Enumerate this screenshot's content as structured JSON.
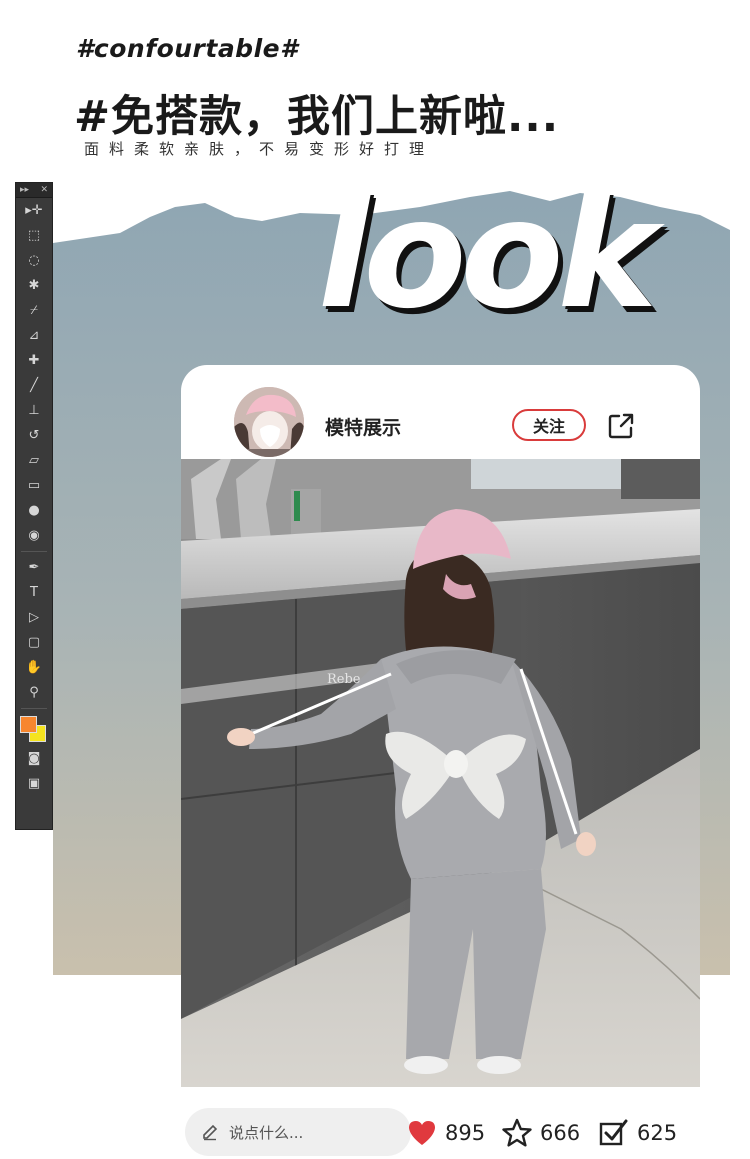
{
  "header": {
    "hashtag": "#confourtable#",
    "headline": "#免搭款，我们上新啦...",
    "subline": "面料柔软亲肤，不易变形好打理"
  },
  "banner": {
    "word": "look",
    "colors": {
      "top": "#8fa6b3",
      "bottom": "#c7bfae"
    }
  },
  "toolbar": {
    "header_left": "▸▸",
    "header_right": "✕",
    "tools": [
      {
        "name": "move-tool-icon",
        "glyph": "▸✛"
      },
      {
        "name": "marquee-tool-icon",
        "glyph": "⬚"
      },
      {
        "name": "lasso-tool-icon",
        "glyph": "◌"
      },
      {
        "name": "magic-wand-tool-icon",
        "glyph": "✱"
      },
      {
        "name": "crop-tool-icon",
        "glyph": "⌿"
      },
      {
        "name": "eyedropper-tool-icon",
        "glyph": "⊿"
      },
      {
        "name": "healing-brush-tool-icon",
        "glyph": "✚"
      },
      {
        "name": "brush-tool-icon",
        "glyph": "╱"
      },
      {
        "name": "stamp-tool-icon",
        "glyph": "⊥"
      },
      {
        "name": "history-brush-tool-icon",
        "glyph": "↺"
      },
      {
        "name": "eraser-tool-icon",
        "glyph": "▱"
      },
      {
        "name": "gradient-tool-icon",
        "glyph": "▭"
      },
      {
        "name": "blur-tool-icon",
        "glyph": "●"
      },
      {
        "name": "dodge-tool-icon",
        "glyph": "◉"
      },
      {
        "name": "pen-tool-icon",
        "glyph": "✒"
      },
      {
        "name": "type-tool-icon",
        "glyph": "T"
      },
      {
        "name": "path-select-tool-icon",
        "glyph": "▷"
      },
      {
        "name": "shape-tool-icon",
        "glyph": "▢"
      },
      {
        "name": "hand-tool-icon",
        "glyph": "✋"
      },
      {
        "name": "zoom-tool-icon",
        "glyph": "⚲"
      }
    ],
    "bottom_tools": [
      {
        "name": "quick-mask-icon",
        "glyph": "◙"
      },
      {
        "name": "screen-mode-icon",
        "glyph": "▣"
      }
    ],
    "foreground_color": "#f7862e",
    "background_color": "#f5e41f"
  },
  "card": {
    "profile_name": "模特展示",
    "follow_label": "关注",
    "photo_sign_text": "Rebe"
  },
  "bottom_bar": {
    "comment_placeholder": "说点什么...",
    "likes": "895",
    "stars": "666",
    "checks": "625",
    "like_color": "#e0393e"
  }
}
